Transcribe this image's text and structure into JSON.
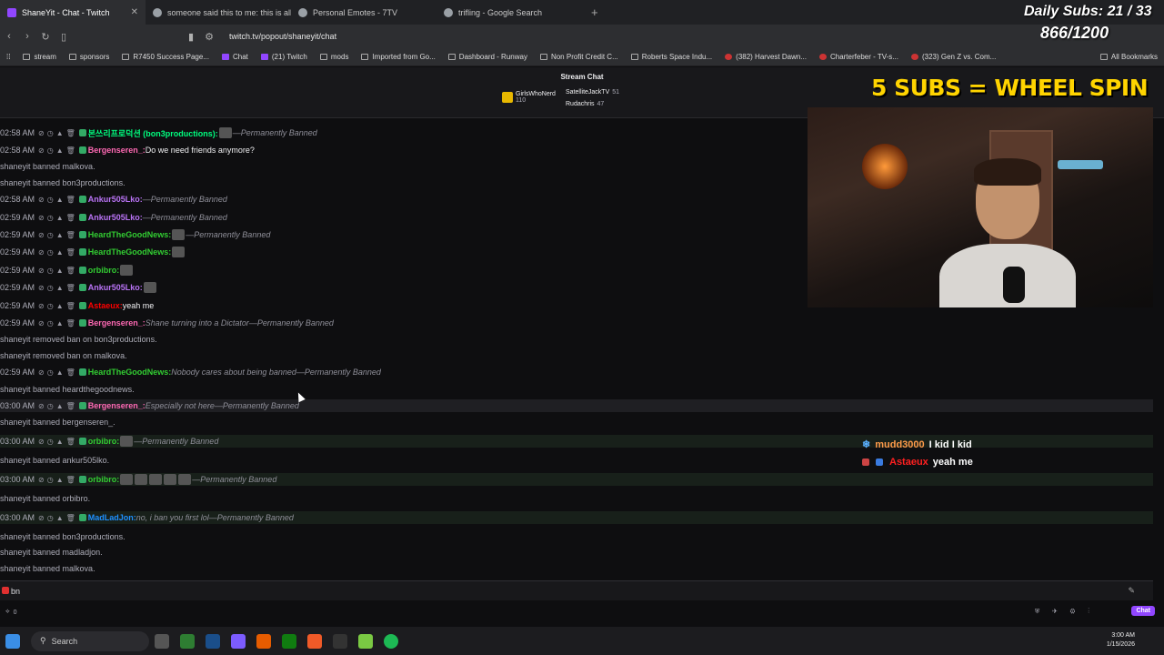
{
  "tabs": [
    {
      "title": "ShaneYit - Chat - Twitch",
      "active": true
    },
    {
      "title": "someone said this to me: this is all a"
    },
    {
      "title": "Personal Emotes - 7TV"
    },
    {
      "title": "trifling - Google Search"
    }
  ],
  "address": "twitch.tv/popout/shaneyit/chat",
  "bookmarks": [
    "stream",
    "sponsors",
    "R7450 Success Page...",
    "Chat",
    "(21) Twitch",
    "mods",
    "Imported from Go...",
    "Dashboard - Runway",
    "Non Profit Credit C...",
    "Roberts Space Indu...",
    "(382) Harvest Dawn...",
    "Charterfeber - TV-s...",
    "(323) Gen Z vs. Com...",
    "All Bookmarks"
  ],
  "stream_chat_title": "Stream Chat",
  "pinned": {
    "gifter": "GirlsWhoNerd",
    "gifter_count": "110",
    "top1": "SatelliteJackTV",
    "top1_count": "51",
    "top2": "Rudachris",
    "top2_count": "47"
  },
  "overlay": {
    "daily_subs": "Daily Subs: 21 / 33",
    "counter": "866/1200",
    "wheel": "5 SUBS = WHEEL SPIN"
  },
  "chat": [
    {
      "ts": "02:58 AM",
      "user": "본쓰리프로덕션 (bon3productions)",
      "color": "#00ff7f",
      "msg": "",
      "banned": "—Permanently Banned",
      "emotes": 1
    },
    {
      "ts": "02:58 AM",
      "user": "Bergenseren_",
      "color": "#ff69b4",
      "msg": "Do we need friends anymore?",
      "banned": ""
    },
    {
      "sys": "shaneyit banned malkova."
    },
    {
      "sys": "shaneyit banned bon3productions."
    },
    {
      "ts": "02:58 AM",
      "user": "Ankur505Lko",
      "color": "#b973f5",
      "msg": "",
      "banned": "—Permanently Banned",
      "emotes": 0
    },
    {
      "ts": "02:59 AM",
      "user": "Ankur505Lko",
      "color": "#b973f5",
      "msg": "",
      "banned": "—Permanently Banned",
      "emotes": 0
    },
    {
      "ts": "02:59 AM",
      "user": "HeardTheGoodNews",
      "color": "#32cd32",
      "msg": "",
      "banned": "—Permanently Banned",
      "emotes": 1
    },
    {
      "ts": "02:59 AM",
      "user": "HeardTheGoodNews",
      "color": "#32cd32",
      "msg": "",
      "banned": "",
      "emotes": 1
    },
    {
      "ts": "02:59 AM",
      "user": "orbibro",
      "color": "#32cd32",
      "msg": "",
      "banned": "",
      "emotes": 1
    },
    {
      "ts": "02:59 AM",
      "user": "Ankur505Lko",
      "color": "#b973f5",
      "msg": "",
      "banned": "",
      "emotes": 1
    },
    {
      "ts": "02:59 AM",
      "user": "Astaeux",
      "color": "#ff0000",
      "msg": "yeah me",
      "banned": ""
    },
    {
      "ts": "02:59 AM",
      "user": "Bergenseren_",
      "color": "#ff69b4",
      "msg": "",
      "banned": "Shane turning into a Dictator—Permanently Banned"
    },
    {
      "sys": "shaneyit removed ban on bon3productions."
    },
    {
      "sys": "shaneyit removed ban on malkova."
    },
    {
      "ts": "02:59 AM",
      "user": "HeardTheGoodNews",
      "color": "#32cd32",
      "msg": "",
      "banned": "Nobody cares about being banned—Permanently Banned"
    },
    {
      "sys": "shaneyit banned heardthegoodnews."
    },
    {
      "ts": "03:00 AM",
      "user": "Bergenseren_",
      "color": "#ff69b4",
      "msg": "",
      "banned": "Especially not here—Permanently Banned"
    },
    {
      "sys": "shaneyit banned bergenseren_."
    },
    {
      "ts": "03:00 AM",
      "user": "orbibro",
      "color": "#32cd32",
      "msg": "",
      "banned": "—Permanently Banned",
      "emotes": 1
    },
    {
      "sys": "shaneyit banned ankur505lko."
    },
    {
      "ts": "03:00 AM",
      "user": "orbibro",
      "color": "#32cd32",
      "msg": "",
      "banned": "—Permanently Banned",
      "emotes": 5
    },
    {
      "sys": "shaneyit banned orbibro."
    },
    {
      "ts": "03:00 AM",
      "user": "MadLadJon",
      "color": "#1e90ff",
      "msg": "",
      "banned": "no, i ban you first lol—Permanently Banned"
    },
    {
      "sys": "shaneyit banned bon3productions."
    },
    {
      "sys": "shaneyit banned madladjon."
    },
    {
      "sys": "shaneyit banned malkova."
    }
  ],
  "overlay_chat": [
    {
      "user": "mudd3000",
      "color": "#ff9b4a",
      "msg": "I kid I kid"
    },
    {
      "user": "Astaeux",
      "color": "#ff2020",
      "msg": "yeah me"
    }
  ],
  "input_value": "bn",
  "chat_button": "Chat",
  "bottom_points": "0",
  "taskbar": {
    "search": "Search",
    "time": "3:00 AM",
    "date": "1/15/2026"
  }
}
